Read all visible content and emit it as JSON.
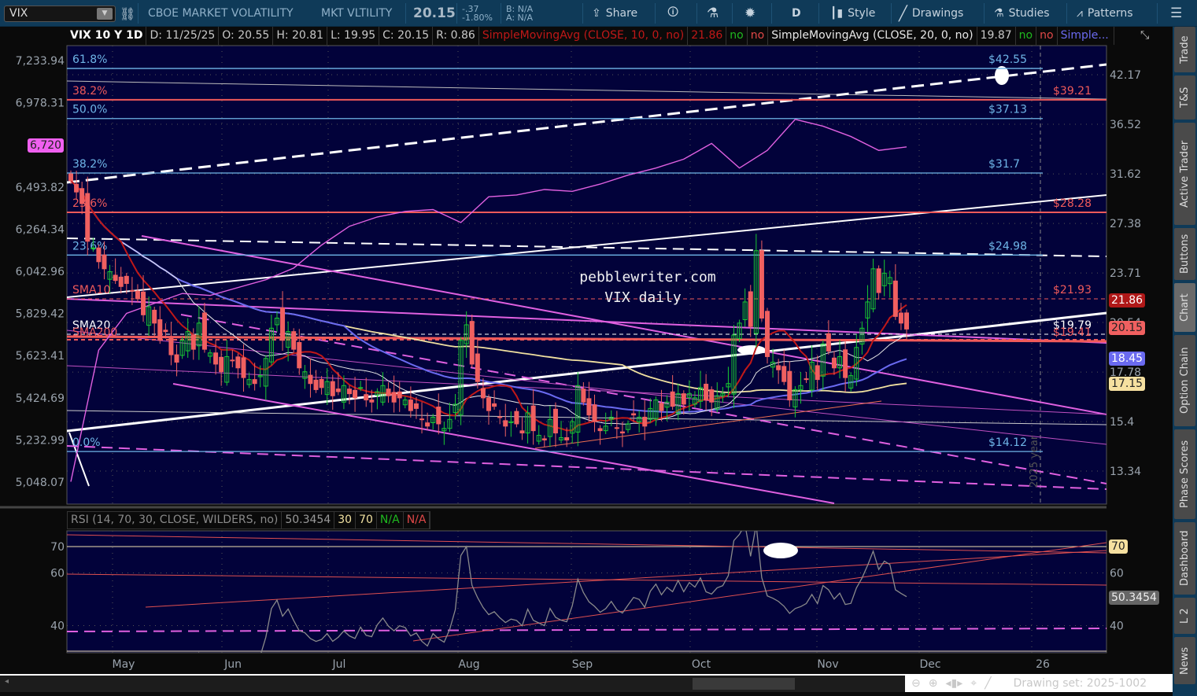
{
  "toolbar": {
    "symbol": "VIX",
    "description": "CBOE MARKET VOLATILITY",
    "short_name": "MKT VLTILITY",
    "last": "20.15",
    "change": "-.37",
    "change_pct": "-1.80%",
    "bid": "B: N/A",
    "ask": "A: N/A",
    "share": "Share",
    "aggregation": "D",
    "style": "Style",
    "drawings": "Drawings",
    "studies": "Studies",
    "patterns": "Patterns"
  },
  "header": {
    "title": "VIX 10 Y 1D",
    "date": "D: 11/25/25",
    "open": "O: 20.55",
    "high": "H: 20.81",
    "low": "L: 19.95",
    "close": "C: 20.15",
    "range": "R: 0.86",
    "sma10_label": "SimpleMovingAvg (CLOSE, 10, 0, no)",
    "sma10_value": "21.86",
    "sma10_flag1": "no",
    "sma10_flag2": "no",
    "sma20_label": "SimpleMovingAvg (CLOSE, 20, 0, no)",
    "sma20_value": "19.87",
    "sma20_flag1": "no",
    "sma20_flag2": "no",
    "more_label": "Simple..."
  },
  "price_axis": {
    "ticks": [
      "42.17",
      "36.52",
      "31.62",
      "27.38",
      "23.71",
      "20.54",
      "17.78",
      "15.4",
      "13.34"
    ],
    "badges": {
      "sma10": "21.86",
      "last": "20.15",
      "sma50": "18.45",
      "sma100": "17.15"
    }
  },
  "compare_axis": {
    "ticks": [
      "7,233.94",
      "6,978.31",
      "6,493.82",
      "6,264.34",
      "6,042.96",
      "5,829.42",
      "5,623.41",
      "5,424.69",
      "5,232.99",
      "5,048.07"
    ],
    "badge": "6,720"
  },
  "fib_levels": [
    {
      "pct": "61.8%",
      "price": "$42.55",
      "value": 42.55,
      "color": "#6fb6e8"
    },
    {
      "pct": "38.2%",
      "price": "$39.21",
      "value": 39.21,
      "color": "#f05a5a"
    },
    {
      "pct": "50.0%",
      "price": "$37.13",
      "value": 37.13,
      "color": "#6fb6e8"
    },
    {
      "pct": "38.2%",
      "price": "$31.7",
      "value": 31.7,
      "color": "#6fb6e8"
    },
    {
      "pct": "23.6%",
      "price": "$28.28",
      "value": 28.28,
      "color": "#f05a5a"
    },
    {
      "pct": "23.6%",
      "price": "$24.98",
      "value": 24.98,
      "color": "#6fb6e8"
    },
    {
      "pct": "0.0%",
      "price": "$14.12",
      "value": 14.12,
      "color": "#6fb6e8"
    }
  ],
  "sma_labels": {
    "sma10": "SMA10",
    "sma20": "SMA20",
    "sma200": "SMA200",
    "sma10_price": "$21.93",
    "sma20_price": "$19.79",
    "sma200_price": "$19.41"
  },
  "watermark": {
    "line1": "pebblewriter.com",
    "line2": "VIX daily",
    "year_marker": "2025 year"
  },
  "x_axis": [
    "May",
    "Jun",
    "Jul",
    "Aug",
    "Sep",
    "Oct",
    "Nov",
    "Dec",
    "26"
  ],
  "rsi": {
    "label": "RSI (14, 70, 30, CLOSE, WILDERS, no)",
    "value": "50.3454",
    "ob": "30",
    "os": "70",
    "na1": "N/A",
    "na2": "N/A",
    "ticks": [
      "70",
      "60",
      "40"
    ],
    "badge70": "70"
  },
  "bottom": {
    "drawing_set": "Drawing set: 2025-1002"
  },
  "side_tabs": [
    "Trade",
    "T&S",
    "Active Trader",
    "Buttons",
    "Chart",
    "Option Chain",
    "Phase Scores",
    "Dashboard",
    "L 2",
    "News"
  ],
  "colors": {
    "up": "#19c832",
    "down": "#f06060",
    "bg": "#02023a",
    "sma10": "#c01818",
    "sma20": "#e8e8e8",
    "sma50": "#6a6af0",
    "sma100": "#f0e0a0",
    "spx": "#e060e0"
  },
  "vix_closes": [
    31,
    30,
    29,
    26,
    25.5,
    24.5,
    24,
    23.8,
    23.2,
    22.8,
    23,
    22.5,
    22,
    21,
    21.5,
    20.5,
    19.5,
    20,
    18.7,
    18.3,
    19.5,
    20,
    19,
    20.5,
    19,
    18.8,
    18.2,
    17.8,
    18.6,
    18.4,
    18,
    17.5,
    17.4,
    17.2,
    17.6,
    18.5,
    20.2,
    20.8,
    19.5,
    20,
    19,
    18,
    17.8,
    17.2,
    16.9,
    17,
    17.3,
    16.6,
    16.8,
    17.1,
    16.7,
    16.5,
    17,
    16.4,
    16.3,
    16.8,
    17.1,
    16.6,
    16.3,
    16.5,
    16.4,
    15.9,
    16,
    15.5,
    15.2,
    15.6,
    15.3,
    15.1,
    15.5,
    16.2,
    19.5,
    20.4,
    18.2,
    17.3,
    16.5,
    15.9,
    16.1,
    15.6,
    15.2,
    15.4,
    15.3,
    14.9,
    15.8,
    15,
    14.8,
    14.6,
    15.5,
    14.9,
    14.7,
    14.6,
    15.4,
    17.1,
    16.3,
    15.7,
    15.4,
    15,
    15.2,
    15.6,
    15.1,
    14.9,
    15.3,
    15.7,
    15.6,
    15.2,
    16,
    16.4,
    15.9,
    16.3,
    16.1,
    16.7,
    16.2,
    16.7,
    16.5,
    17,
    16.4,
    16.3,
    16.6,
    16.7,
    17.2,
    19.8,
    20.5,
    21.8,
    20.3,
    25.3,
    20.8,
    18.6,
    18.3,
    17.9,
    17.3,
    16.4,
    16.9,
    17.1,
    17.4,
    18.3,
    17.4,
    19.3,
    18.9,
    18,
    18.6,
    17.5,
    17.6,
    19.1,
    20.2,
    21.8,
    24,
    22.4,
    23.7,
    23.4,
    20.9,
    20.5,
    20.15
  ],
  "spx_overlay_every5": [
    5050,
    5650,
    5830,
    5880,
    5930,
    5920,
    5960,
    6000,
    6060,
    6180,
    6280,
    6330,
    6360,
    6370,
    6300,
    6440,
    6450,
    6480,
    6470,
    6510,
    6560,
    6600,
    6650,
    6740,
    6600,
    6700,
    6880,
    6840,
    6780,
    6700,
    6720
  ]
}
